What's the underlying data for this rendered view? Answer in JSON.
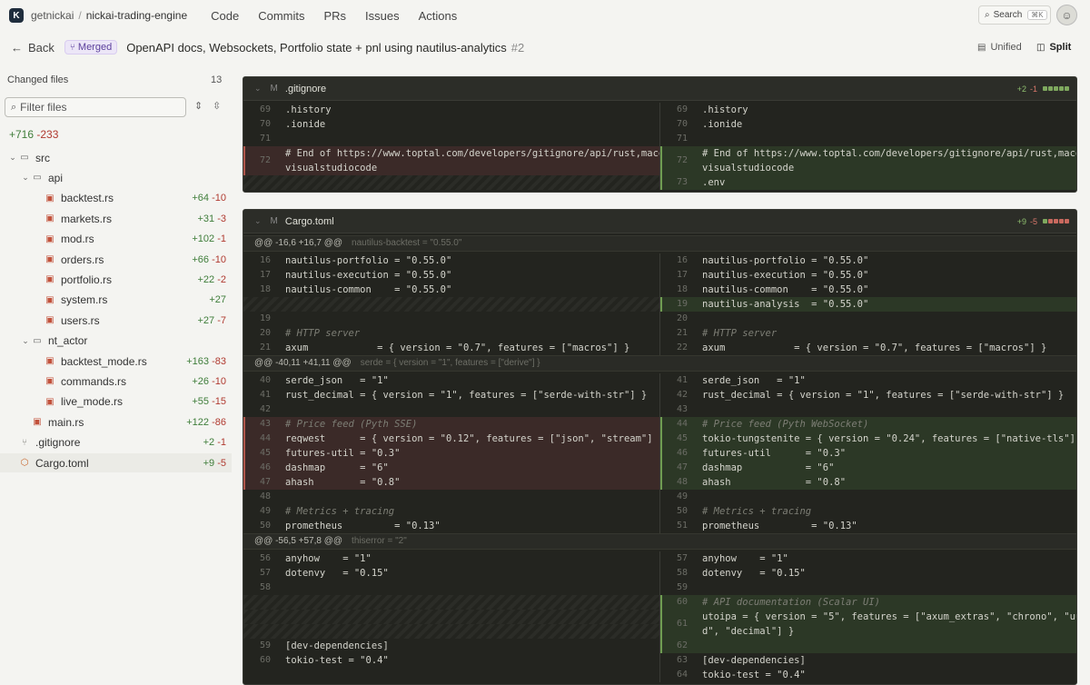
{
  "nav": {
    "logo": "K",
    "owner": "getnickai",
    "separator": "/",
    "repo": "nickai-trading-engine",
    "links": [
      "Code",
      "Commits",
      "PRs",
      "Issues",
      "Actions"
    ],
    "search_label": "Search",
    "search_kbd": "⌘K"
  },
  "pr": {
    "back_label": "Back",
    "status": "Merged",
    "title": "OpenAPI docs, Websockets, Portfolio state + pnl using nautilus-analytics",
    "number": "#2",
    "view_unified": "Unified",
    "view_split": "Split",
    "active_view": "split"
  },
  "sidebar": {
    "label": "Changed files",
    "count": "13",
    "filter_placeholder": "Filter files",
    "total_add": "+716",
    "total_del": "-233",
    "tree": [
      {
        "name": "src",
        "type": "folder",
        "depth": 0,
        "add": "",
        "del": ""
      },
      {
        "name": "api",
        "type": "folder",
        "depth": 1,
        "add": "",
        "del": ""
      },
      {
        "name": "backtest.rs",
        "type": "rs",
        "depth": 2,
        "add": "+64",
        "del": "-10"
      },
      {
        "name": "markets.rs",
        "type": "rs",
        "depth": 2,
        "add": "+31",
        "del": "-3"
      },
      {
        "name": "mod.rs",
        "type": "rs",
        "depth": 2,
        "add": "+102",
        "del": "-1"
      },
      {
        "name": "orders.rs",
        "type": "rs",
        "depth": 2,
        "add": "+66",
        "del": "-10"
      },
      {
        "name": "portfolio.rs",
        "type": "rs",
        "depth": 2,
        "add": "+22",
        "del": "-2"
      },
      {
        "name": "system.rs",
        "type": "rs",
        "depth": 2,
        "add": "+27",
        "del": ""
      },
      {
        "name": "users.rs",
        "type": "rs",
        "depth": 2,
        "add": "+27",
        "del": "-7"
      },
      {
        "name": "nt_actor",
        "type": "folder",
        "depth": 1,
        "add": "",
        "del": ""
      },
      {
        "name": "backtest_mode.rs",
        "type": "rs",
        "depth": 2,
        "add": "+163",
        "del": "-83"
      },
      {
        "name": "commands.rs",
        "type": "rs",
        "depth": 2,
        "add": "+26",
        "del": "-10"
      },
      {
        "name": "live_mode.rs",
        "type": "rs",
        "depth": 2,
        "add": "+55",
        "del": "-15"
      },
      {
        "name": "main.rs",
        "type": "rs",
        "depth": 1,
        "add": "+122",
        "del": "-86"
      },
      {
        "name": ".gitignore",
        "type": "git",
        "depth": 0,
        "add": "+2",
        "del": "-1"
      },
      {
        "name": "Cargo.toml",
        "type": "toml",
        "depth": 0,
        "add": "+9",
        "del": "-5",
        "selected": true
      }
    ]
  },
  "files": [
    {
      "status": "M",
      "path": ".gitignore",
      "add": "+2",
      "del": "-1",
      "bars": [
        "g",
        "g",
        "g",
        "g",
        "g"
      ],
      "left": [
        {
          "n": "69",
          "t": ".history",
          "k": ""
        },
        {
          "n": "70",
          "t": ".ionide",
          "k": ""
        },
        {
          "n": "71",
          "t": "",
          "k": ""
        },
        {
          "n": "72",
          "t": "# End of https://www.toptal.com/developers/gitignore/api/rust,macos,\nvisualstudiocode",
          "k": "del"
        },
        {
          "n": "",
          "t": "",
          "k": "hatch"
        }
      ],
      "right": [
        {
          "n": "69",
          "t": ".history",
          "k": ""
        },
        {
          "n": "70",
          "t": ".ionide",
          "k": ""
        },
        {
          "n": "71",
          "t": "",
          "k": ""
        },
        {
          "n": "72",
          "t": "# End of https://www.toptal.com/developers/gitignore/api/rust,macos,\nvisualstudiocode",
          "k": "add"
        },
        {
          "n": "73",
          "t": ".env",
          "k": "add"
        }
      ]
    },
    {
      "status": "M",
      "path": "Cargo.toml",
      "add": "+9",
      "del": "-5",
      "bars": [
        "g",
        "r",
        "r",
        "r",
        "r"
      ],
      "hunks": [
        {
          "header": "@@ -16,6 +16,7 @@",
          "ctx": "nautilus-backtest = \"0.55.0\""
        },
        {
          "header": "@@ -40,11 +41,11 @@",
          "ctx": "serde = { version = \"1\", features = [\"derive\"] }"
        },
        {
          "header": "@@ -56,5 +57,8 @@",
          "ctx": "thiserror = \"2\""
        }
      ],
      "left": [
        {
          "n": "16",
          "t": "nautilus-portfolio = \"0.55.0\"",
          "k": ""
        },
        {
          "n": "17",
          "t": "nautilus-execution = \"0.55.0\"",
          "k": ""
        },
        {
          "n": "18",
          "t": "nautilus-common    = \"0.55.0\"",
          "k": ""
        },
        {
          "n": "",
          "t": "",
          "k": "hatch"
        },
        {
          "n": "19",
          "t": "",
          "k": ""
        },
        {
          "n": "20",
          "t": "# HTTP server",
          "k": "cm"
        },
        {
          "n": "21",
          "t": "axum            = { version = \"0.7\", features = [\"macros\"] }",
          "k": ""
        },
        {
          "n": "40",
          "t": "serde_json   = \"1\"",
          "k": ""
        },
        {
          "n": "41",
          "t": "rust_decimal = { version = \"1\", features = [\"serde-with-str\"] }",
          "k": ""
        },
        {
          "n": "42",
          "t": "",
          "k": ""
        },
        {
          "n": "43",
          "t": "# Price feed (Pyth SSE)",
          "k": "delcm"
        },
        {
          "n": "44",
          "t": "reqwest      = { version = \"0.12\", features = [\"json\", \"stream\"] }",
          "k": "del"
        },
        {
          "n": "45",
          "t": "futures-util = \"0.3\"",
          "k": "del"
        },
        {
          "n": "46",
          "t": "dashmap      = \"6\"",
          "k": "del"
        },
        {
          "n": "47",
          "t": "ahash        = \"0.8\"",
          "k": "del"
        },
        {
          "n": "48",
          "t": "",
          "k": ""
        },
        {
          "n": "49",
          "t": "# Metrics + tracing",
          "k": "cm"
        },
        {
          "n": "50",
          "t": "prometheus         = \"0.13\"",
          "k": ""
        },
        {
          "n": "56",
          "t": "anyhow    = \"1\"",
          "k": ""
        },
        {
          "n": "57",
          "t": "dotenvy   = \"0.15\"",
          "k": ""
        },
        {
          "n": "58",
          "t": "",
          "k": ""
        },
        {
          "n": "",
          "t": "",
          "k": "hatch"
        },
        {
          "n": "",
          "t": "",
          "k": "hatch"
        },
        {
          "n": "",
          "t": "",
          "k": "hatch"
        },
        {
          "n": "59",
          "t": "[dev-dependencies]",
          "k": ""
        },
        {
          "n": "60",
          "t": "tokio-test = \"0.4\"",
          "k": ""
        }
      ],
      "right": [
        {
          "n": "16",
          "t": "nautilus-portfolio = \"0.55.0\"",
          "k": ""
        },
        {
          "n": "17",
          "t": "nautilus-execution = \"0.55.0\"",
          "k": ""
        },
        {
          "n": "18",
          "t": "nautilus-common    = \"0.55.0\"",
          "k": ""
        },
        {
          "n": "19",
          "t": "nautilus-analysis  = \"0.55.0\"",
          "k": "add"
        },
        {
          "n": "20",
          "t": "",
          "k": ""
        },
        {
          "n": "21",
          "t": "# HTTP server",
          "k": "cm"
        },
        {
          "n": "22",
          "t": "axum            = { version = \"0.7\", features = [\"macros\"] }",
          "k": ""
        },
        {
          "n": "41",
          "t": "serde_json   = \"1\"",
          "k": ""
        },
        {
          "n": "42",
          "t": "rust_decimal = { version = \"1\", features = [\"serde-with-str\"] }",
          "k": ""
        },
        {
          "n": "43",
          "t": "",
          "k": ""
        },
        {
          "n": "44",
          "t": "# Price feed (Pyth WebSocket)",
          "k": "addcm"
        },
        {
          "n": "45",
          "t": "tokio-tungstenite = { version = \"0.24\", features = [\"native-tls\"] }",
          "k": "add"
        },
        {
          "n": "46",
          "t": "futures-util      = \"0.3\"",
          "k": "add"
        },
        {
          "n": "47",
          "t": "dashmap           = \"6\"",
          "k": "add"
        },
        {
          "n": "48",
          "t": "ahash             = \"0.8\"",
          "k": "add"
        },
        {
          "n": "49",
          "t": "",
          "k": ""
        },
        {
          "n": "50",
          "t": "# Metrics + tracing",
          "k": "cm"
        },
        {
          "n": "51",
          "t": "prometheus         = \"0.13\"",
          "k": ""
        },
        {
          "n": "57",
          "t": "anyhow    = \"1\"",
          "k": ""
        },
        {
          "n": "58",
          "t": "dotenvy   = \"0.15\"",
          "k": ""
        },
        {
          "n": "59",
          "t": "",
          "k": ""
        },
        {
          "n": "60",
          "t": "# API documentation (Scalar UI)",
          "k": "addcm"
        },
        {
          "n": "61",
          "t": "utoipa = { version = \"5\", features = [\"axum_extras\", \"chrono\", \"uui\nd\", \"decimal\"] }",
          "k": "add"
        },
        {
          "n": "62",
          "t": "",
          "k": "add"
        },
        {
          "n": "63",
          "t": "[dev-dependencies]",
          "k": ""
        },
        {
          "n": "64",
          "t": "tokio-test = \"0.4\"",
          "k": ""
        }
      ]
    }
  ]
}
